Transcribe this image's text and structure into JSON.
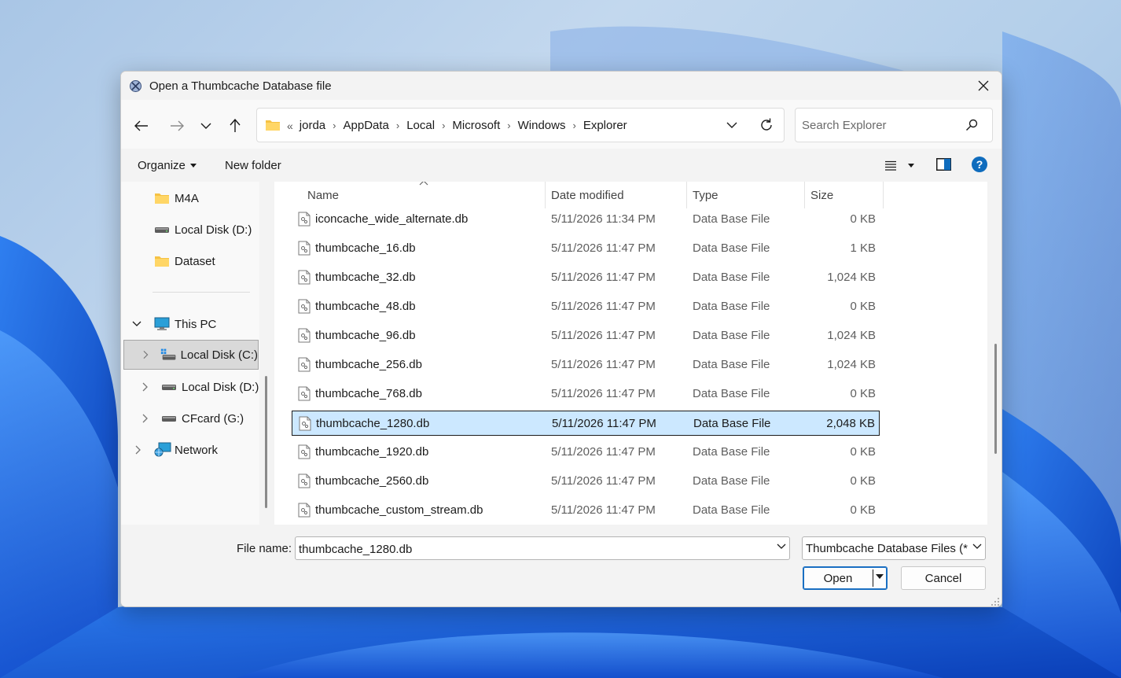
{
  "dialog": {
    "title": "Open a Thumbcache Database file"
  },
  "address": {
    "overflow": "«",
    "crumbs": [
      "jorda",
      "AppData",
      "Local",
      "Microsoft",
      "Windows",
      "Explorer"
    ]
  },
  "search": {
    "placeholder": "Search Explorer"
  },
  "toolbar": {
    "organize_label": "Organize",
    "new_folder_label": "New folder"
  },
  "nav_tree": {
    "m4a": "M4A",
    "local_disk_d_quick": "Local Disk (D:)",
    "dataset": "Dataset",
    "this_pc": "This PC",
    "local_disk_c": "Local Disk (C:)",
    "local_disk_d": "Local Disk (D:)",
    "cfcard_g": "CFcard (G:)",
    "network": "Network"
  },
  "columns": {
    "name": "Name",
    "date": "Date modified",
    "type": "Type",
    "size": "Size"
  },
  "files": [
    {
      "name": "iconcache_wide_alternate.db",
      "date": "5/11/2026 11:34 PM",
      "type": "Data Base File",
      "size": "0 KB"
    },
    {
      "name": "thumbcache_16.db",
      "date": "5/11/2026 11:47 PM",
      "type": "Data Base File",
      "size": "1 KB"
    },
    {
      "name": "thumbcache_32.db",
      "date": "5/11/2026 11:47 PM",
      "type": "Data Base File",
      "size": "1,024 KB"
    },
    {
      "name": "thumbcache_48.db",
      "date": "5/11/2026 11:47 PM",
      "type": "Data Base File",
      "size": "0 KB"
    },
    {
      "name": "thumbcache_96.db",
      "date": "5/11/2026 11:47 PM",
      "type": "Data Base File",
      "size": "1,024 KB"
    },
    {
      "name": "thumbcache_256.db",
      "date": "5/11/2026 11:47 PM",
      "type": "Data Base File",
      "size": "1,024 KB"
    },
    {
      "name": "thumbcache_768.db",
      "date": "5/11/2026 11:47 PM",
      "type": "Data Base File",
      "size": "0 KB"
    },
    {
      "name": "thumbcache_1280.db",
      "date": "5/11/2026 11:47 PM",
      "type": "Data Base File",
      "size": "2,048 KB"
    },
    {
      "name": "thumbcache_1920.db",
      "date": "5/11/2026 11:47 PM",
      "type": "Data Base File",
      "size": "0 KB"
    },
    {
      "name": "thumbcache_2560.db",
      "date": "5/11/2026 11:47 PM",
      "type": "Data Base File",
      "size": "0 KB"
    },
    {
      "name": "thumbcache_custom_stream.db",
      "date": "5/11/2026 11:47 PM",
      "type": "Data Base File",
      "size": "0 KB"
    }
  ],
  "selected_file_index": 7,
  "bottom": {
    "file_name_label": "File name:",
    "file_name_value": "thumbcache_1280.db",
    "file_type_value": "Thumbcache Database Files (*.db)",
    "open_label": "Open",
    "cancel_label": "Cancel"
  },
  "colors": {
    "accent": "#1a6fc2",
    "selection": "#cce8ff",
    "help": "#0f6cbd",
    "folder": "#f6c244"
  }
}
